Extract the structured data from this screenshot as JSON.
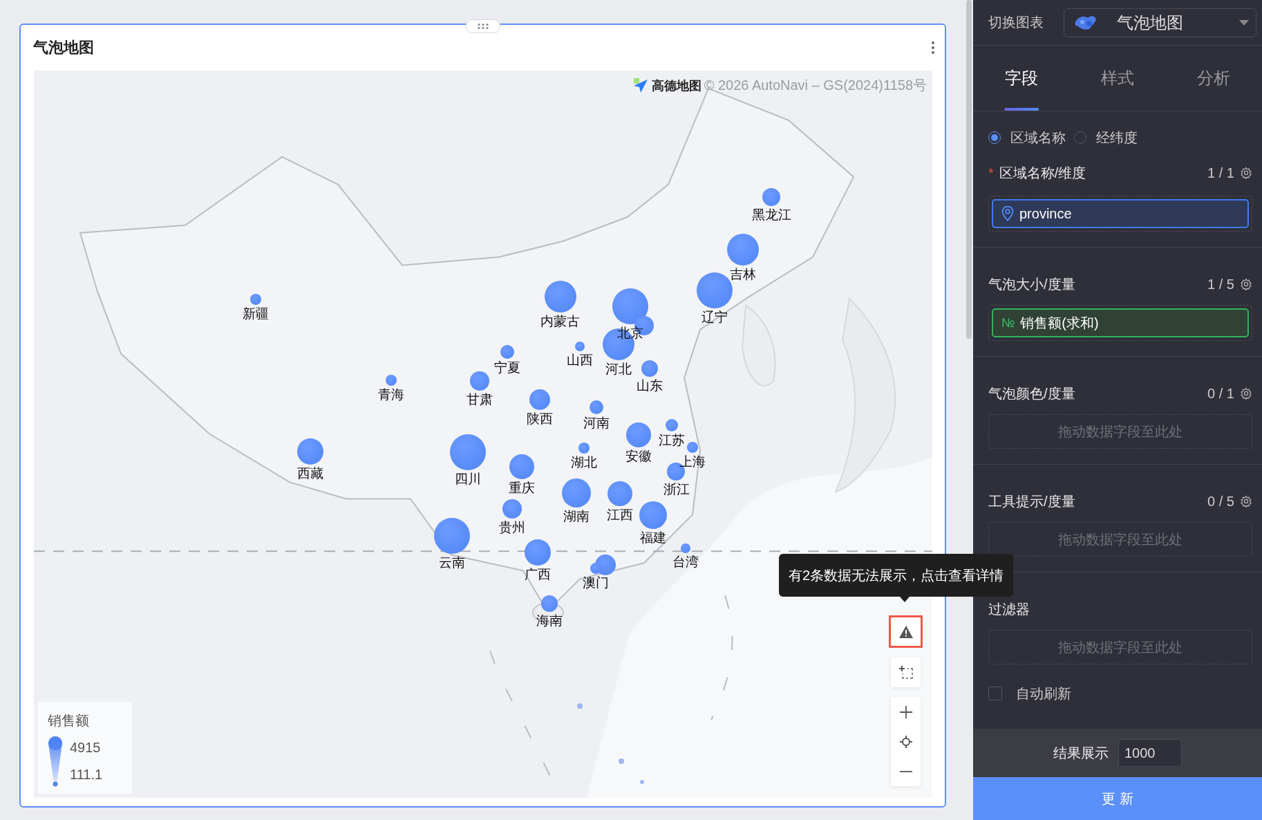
{
  "chart_switcher": {
    "label": "切换图表",
    "value": "气泡地图"
  },
  "card": {
    "title": "气泡地图"
  },
  "map": {
    "attribution_brand": "高德地图",
    "attribution": "© 2026 AutoNavi – GS(2024)1158号",
    "bubbles": [
      {
        "kind": "labeled",
        "label": "黑龙江"
      },
      {
        "kind": "labeled",
        "label": "吉林"
      },
      {
        "kind": "labeled",
        "label": "新疆"
      },
      {
        "kind": "labeled",
        "label": "内蒙古"
      },
      {
        "kind": "labeled",
        "label": "北京"
      },
      {
        "kind": "labeled",
        "label": "辽宁"
      },
      {
        "kind": "unlabeled"
      },
      {
        "kind": "labeled",
        "label": "宁夏"
      },
      {
        "kind": "labeled",
        "label": "山西"
      },
      {
        "kind": "labeled",
        "label": "河北"
      },
      {
        "kind": "labeled",
        "label": "山东"
      },
      {
        "kind": "labeled",
        "label": "青海"
      },
      {
        "kind": "labeled",
        "label": "甘肃"
      },
      {
        "kind": "labeled",
        "label": "陕西"
      },
      {
        "kind": "labeled",
        "label": "河南"
      },
      {
        "kind": "labeled",
        "label": "江苏"
      },
      {
        "kind": "labeled",
        "label": "安徽"
      },
      {
        "kind": "labeled",
        "label": "西藏"
      },
      {
        "kind": "labeled",
        "label": "四川"
      },
      {
        "kind": "labeled",
        "label": "湖北"
      },
      {
        "kind": "labeled",
        "label": "上海"
      },
      {
        "kind": "labeled",
        "label": "重庆"
      },
      {
        "kind": "labeled",
        "label": "浙江"
      },
      {
        "kind": "labeled",
        "label": "湖南"
      },
      {
        "kind": "labeled",
        "label": "江西"
      },
      {
        "kind": "labeled",
        "label": "贵州"
      },
      {
        "kind": "labeled",
        "label": "福建"
      },
      {
        "kind": "labeled",
        "label": "云南"
      },
      {
        "kind": "labeled",
        "label": "广西"
      },
      {
        "kind": "labeled",
        "label": "台湾"
      },
      {
        "kind": "labeled",
        "label": "澳门"
      },
      {
        "kind": "unlabeled"
      },
      {
        "kind": "labeled",
        "label": "海南"
      }
    ],
    "legend": {
      "title": "销售额",
      "max": "4915",
      "min": "111.1"
    },
    "warning_tooltip": "有2条数据无法展示，点击查看详情"
  },
  "tabs": [
    {
      "label": "字段",
      "selected": true
    },
    {
      "label": "样式",
      "selected": false
    },
    {
      "label": "分析",
      "selected": false
    }
  ],
  "location_mode": [
    {
      "label": "区域名称",
      "selected": true
    },
    {
      "label": "经纬度",
      "selected": false
    }
  ],
  "sections": [
    {
      "marker": "*",
      "title": "区域名称/维度",
      "count": "1 / 1",
      "field": {
        "kind": "dimension",
        "name": "province"
      }
    },
    {
      "title": "气泡大小/度量",
      "count": "1 / 5",
      "field": {
        "kind": "measure",
        "icon_text": "№",
        "name": "销售额(求和)"
      }
    },
    {
      "title": "气泡颜色/度量",
      "count": "0 / 1",
      "placeholder": "拖动数据字段至此处"
    },
    {
      "title": "工具提示/度量",
      "count": "0 / 5",
      "placeholder": "拖动数据字段至此处"
    },
    {
      "title": "过滤器",
      "placeholder": "拖动数据字段至此处"
    }
  ],
  "auto_refresh": {
    "label": "自动刷新",
    "checked": false
  },
  "result_limit": {
    "label": "结果展示",
    "value": "1000"
  },
  "update_button": "更 新"
}
